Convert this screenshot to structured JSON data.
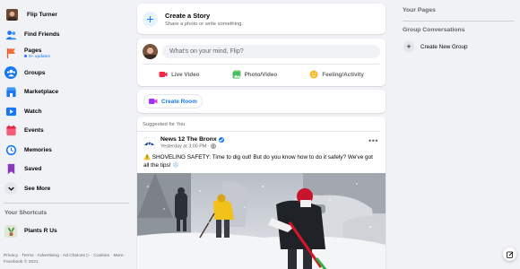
{
  "sidebar": {
    "profile_name": "Flip Turner",
    "items": [
      {
        "label": "Find Friends",
        "icon": "friends-icon"
      },
      {
        "label": "Pages",
        "sub": "9+ updates",
        "icon": "pages-flag-icon"
      },
      {
        "label": "Groups",
        "icon": "groups-icon"
      },
      {
        "label": "Marketplace",
        "icon": "marketplace-icon"
      },
      {
        "label": "Watch",
        "icon": "watch-icon"
      },
      {
        "label": "Events",
        "icon": "events-icon"
      },
      {
        "label": "Memories",
        "icon": "memories-icon"
      },
      {
        "label": "Saved",
        "icon": "saved-icon"
      },
      {
        "label": "See More",
        "icon": "chevron-down-icon"
      }
    ],
    "shortcuts_title": "Your Shortcuts",
    "shortcuts": [
      {
        "label": "Plants R Us"
      }
    ],
    "footer": "Privacy · Terms · Advertising · Ad Choices ▷ · Cookies · More · Facebook © 2021"
  },
  "feed": {
    "story": {
      "title": "Create a Story",
      "subtitle": "Share a photo or write something."
    },
    "composer": {
      "placeholder": "What's on your mind, Flip?",
      "actions": [
        {
          "label": "Live Video",
          "icon": "live-video-icon"
        },
        {
          "label": "Photo/Video",
          "icon": "photo-video-icon"
        },
        {
          "label": "Feeling/Activity",
          "icon": "feeling-icon"
        }
      ]
    },
    "room": {
      "label": "Create Room"
    },
    "post": {
      "suggested": "Suggested for You",
      "page_name": "News 12 The Bronx",
      "logo_text": "12",
      "time": "Yesterday at 3:00 PM · ",
      "text": "⚠️ SHOVELING SAFETY: Time to dig out! But do you know how to do it safely? We've got all the tips! ❄️"
    }
  },
  "right": {
    "pages_title": "Your Pages",
    "group_title": "Group Conversations",
    "create_group": "Create New Group"
  },
  "colors": {
    "accent": "#1877f2",
    "background": "#f0f2f5"
  }
}
